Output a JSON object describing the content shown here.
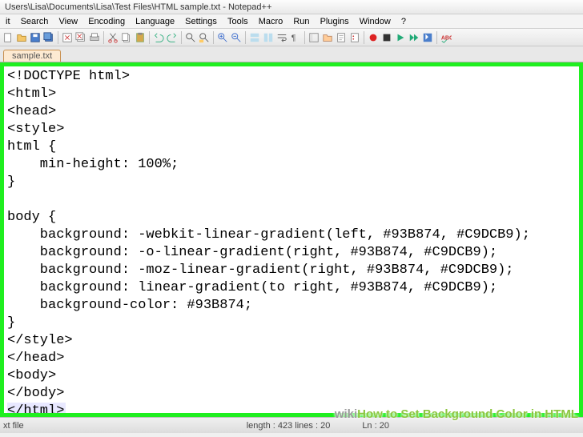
{
  "titlebar": {
    "path": "Users\\Lisa\\Documents\\Lisa\\Test Files\\HTML sample.txt - Notepad++"
  },
  "menus": [
    "it",
    "Search",
    "View",
    "Encoding",
    "Language",
    "Settings",
    "Tools",
    "Macro",
    "Run",
    "Plugins",
    "Window",
    "?"
  ],
  "tab": {
    "name": "sample.txt"
  },
  "code": {
    "l1": "<!DOCTYPE html>",
    "l2": "<html>",
    "l3": "<head>",
    "l4": "<style>",
    "l5": "html {",
    "l6": "    min-height: 100%;",
    "l7": "}",
    "l8": "",
    "l9": "body {",
    "l10": "    background: -webkit-linear-gradient(left, #93B874, #C9DCB9);",
    "l11": "    background: -o-linear-gradient(right, #93B874, #C9DCB9);",
    "l12": "    background: -moz-linear-gradient(right, #93B874, #C9DCB9);",
    "l13": "    background: linear-gradient(to right, #93B874, #C9DCB9);",
    "l14": "    background-color: #93B874;",
    "l15": "}",
    "l16": "</style>",
    "l17": "</head>",
    "l18": "<body>",
    "l19": "</body>",
    "l20": "</html>"
  },
  "status": {
    "filetype": "xt file",
    "length": "length : 423    lines : 20",
    "pos": "Ln : 20"
  },
  "watermark": {
    "brand": "wiki",
    "title": "How to Set Background Color in HTML"
  }
}
